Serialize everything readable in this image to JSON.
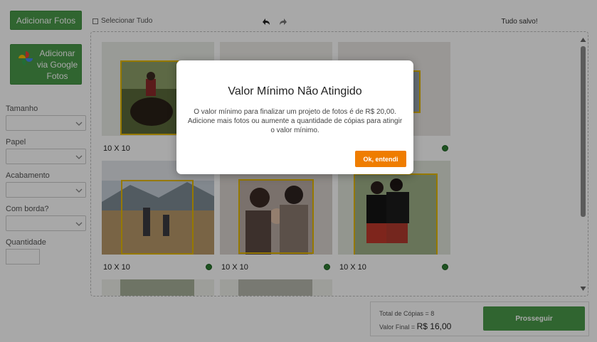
{
  "toolbar": {
    "add_photos_label": "Adicionar Fotos",
    "add_google_label": "Adicionar via Google Fotos",
    "select_all_label": "Selecionar Tudo",
    "saved_status": "Tudo salvo!",
    "icons": [
      "google-photos-icon",
      "undo-icon",
      "redo-icon"
    ]
  },
  "options": {
    "size_label": "Tamanho",
    "paper_label": "Papel",
    "finish_label": "Acabamento",
    "border_label": "Com borda?",
    "quantity_label": "Quantidade",
    "size_value": "",
    "paper_value": "",
    "finish_value": "",
    "border_value": "",
    "quantity_value": ""
  },
  "photos": [
    {
      "caption": "10 X 10",
      "status": "ok"
    },
    {
      "caption": "",
      "status": "ok"
    },
    {
      "caption": "",
      "status": "ok"
    },
    {
      "caption": "10 X 10",
      "status": "ok"
    },
    {
      "caption": "10 X 10",
      "status": "ok"
    },
    {
      "caption": "10 X 10",
      "status": "ok"
    }
  ],
  "summary": {
    "total_copies_label": "Total de Cópias = 8",
    "final_value_label": "Valor Final = ",
    "final_value": "R$ 16,00",
    "proceed_label": "Prosseguir"
  },
  "modal": {
    "title": "Valor Mínimo Não Atingido",
    "body": "O valor mínimo para finalizar um projeto de fotos é de R$ 20,00. Adicione mais fotos ou aumente a quantidade de cópias para atingir o valor mínimo.",
    "ok_label": "Ok, entendi"
  },
  "colors": {
    "primary_green": "#4a9a4a",
    "accent_orange": "#ef7d00",
    "frame_yellow": "#e4b800",
    "ok_green": "#2e7d32"
  }
}
